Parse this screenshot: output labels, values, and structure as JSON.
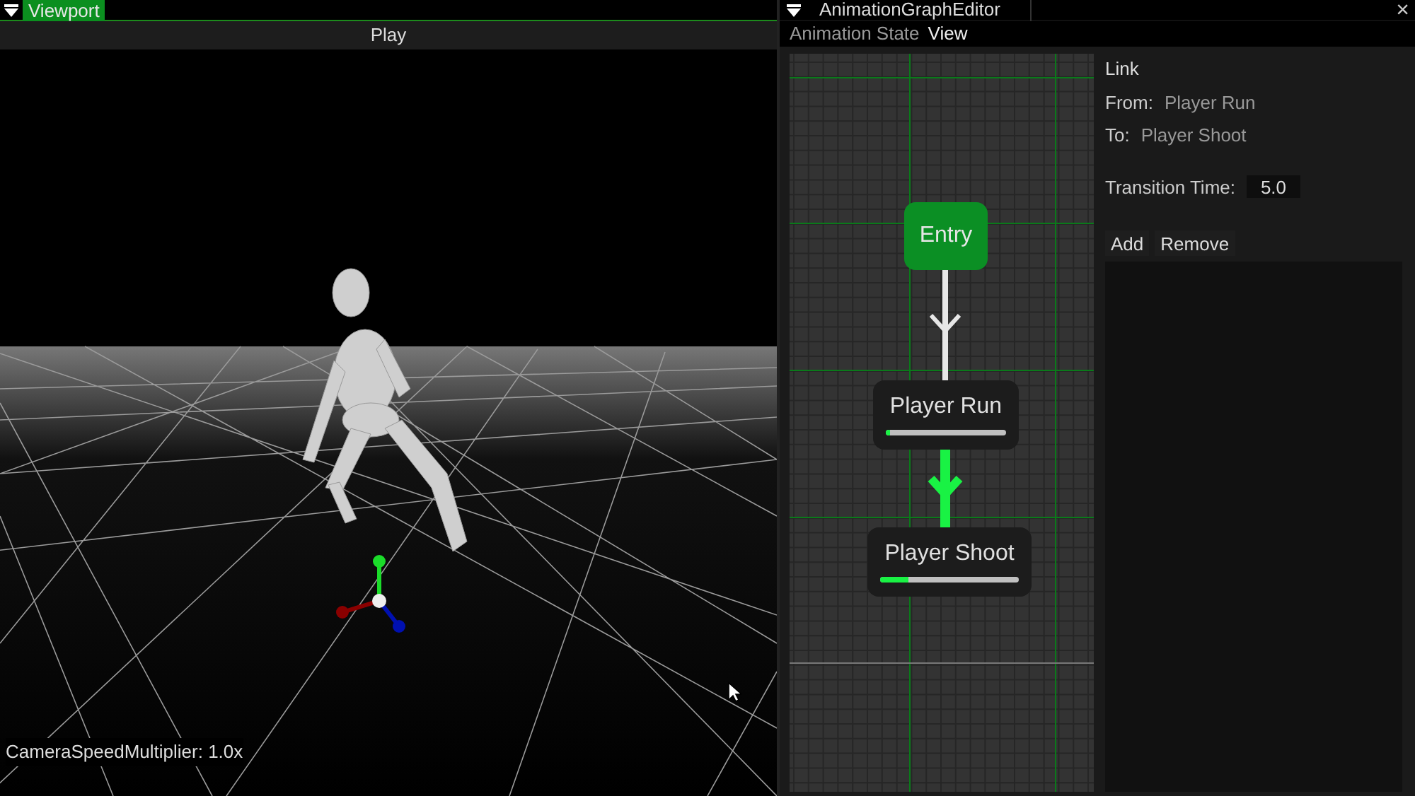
{
  "viewport": {
    "title": "Viewport",
    "play_button": "Play",
    "overlay_text": "CameraSpeedMultiplier: 1.0x"
  },
  "graph_editor": {
    "title": "AnimationGraphEditor",
    "close": "×",
    "menu": [
      {
        "label": "Animation State",
        "selected": false
      },
      {
        "label": "View",
        "selected": true
      }
    ],
    "nodes": [
      {
        "kind": "entry",
        "label": "Entry"
      },
      {
        "kind": "state",
        "label": "Player Run",
        "level": 0.03
      },
      {
        "kind": "state",
        "label": "Player Shoot",
        "level": 0.2
      }
    ],
    "links": [
      {
        "selected": false
      },
      {
        "selected": true
      }
    ]
  },
  "properties": {
    "heading": "Link",
    "from_label": "From:",
    "from_value": "Player Run",
    "to_label": "To:",
    "to_value": "Player Shoot",
    "transition_label": "Transition Time:",
    "transition_value": "5.0",
    "buttons": [
      "Add",
      "Remove"
    ]
  }
}
